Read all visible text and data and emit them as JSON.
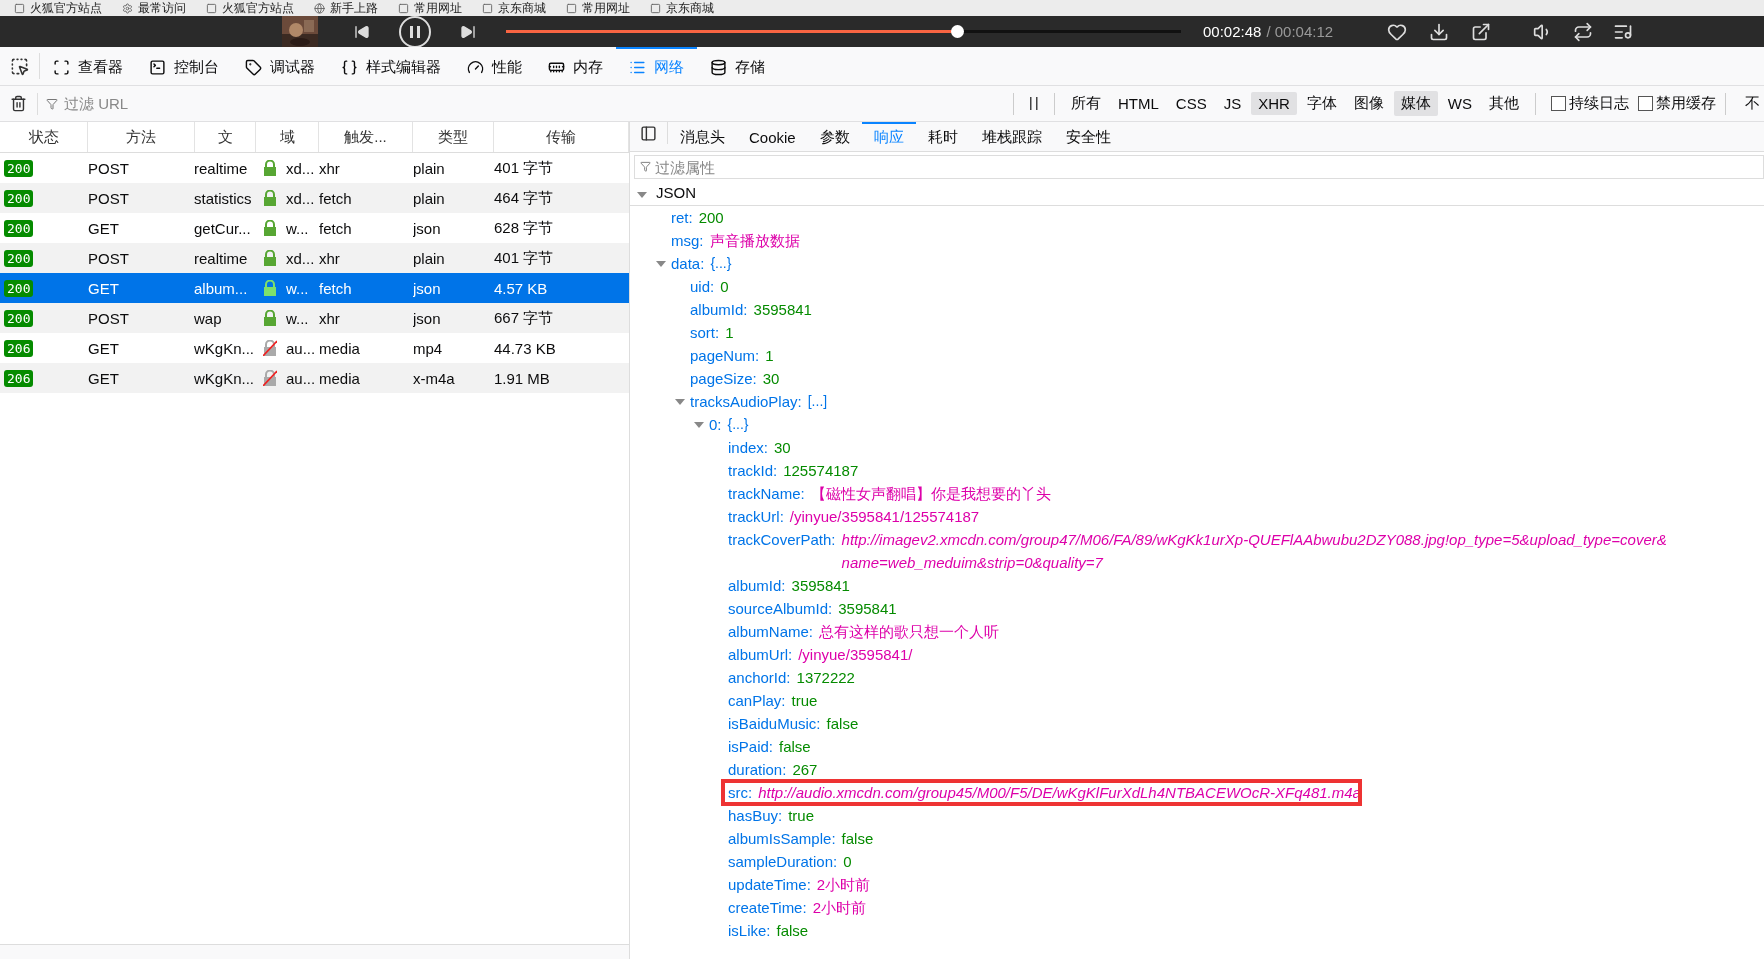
{
  "bookmarks": [
    {
      "label": "火狐官方站点"
    },
    {
      "label": "最常访问"
    },
    {
      "label": "火狐官方站点"
    },
    {
      "label": "新手上路"
    },
    {
      "label": "常用网址"
    },
    {
      "label": "京东商城"
    },
    {
      "label": "常用网址"
    },
    {
      "label": "京东商城"
    }
  ],
  "player": {
    "elapsed": "00:02:48",
    "total": "/ 00:04:12",
    "level": 0.668
  },
  "devtools_tabs": [
    {
      "label": "查看器",
      "selected": false
    },
    {
      "label": "控制台",
      "selected": false
    },
    {
      "label": "调试器",
      "selected": false
    },
    {
      "label": "样式编辑器",
      "selected": false
    },
    {
      "label": "性能",
      "selected": false
    },
    {
      "label": "内存",
      "selected": false
    },
    {
      "label": "网络",
      "selected": true
    },
    {
      "label": "存储",
      "selected": false
    }
  ],
  "filter": {
    "placeholder": "过滤 URL"
  },
  "type_filters": [
    {
      "label": "所有",
      "selected": false
    },
    {
      "label": "HTML",
      "selected": false
    },
    {
      "label": "CSS",
      "selected": false
    },
    {
      "label": "JS",
      "selected": false
    },
    {
      "label": "XHR",
      "selected": true
    },
    {
      "label": "字体",
      "selected": false
    },
    {
      "label": "图像",
      "selected": false
    },
    {
      "label": "媒体",
      "selected": true
    },
    {
      "label": "WS",
      "selected": false
    },
    {
      "label": "其他",
      "selected": false
    }
  ],
  "options": [
    {
      "label": "持续日志",
      "checked": false
    },
    {
      "label": "禁用缓存",
      "checked": false
    }
  ],
  "overflow_label": "不",
  "requests": {
    "columns": [
      "状态",
      "方法",
      "文",
      "域",
      "触发...",
      "类型",
      "传输"
    ],
    "rows": [
      {
        "status": "200",
        "method": "POST",
        "file": "realtime",
        "secure": true,
        "domain": "xd...",
        "cause": "xhr",
        "type": "plain",
        "transferred": "401 字节",
        "selected": false
      },
      {
        "status": "200",
        "method": "POST",
        "file": "statistics",
        "secure": true,
        "domain": "xd...",
        "cause": "fetch",
        "type": "plain",
        "transferred": "464 字节",
        "selected": false
      },
      {
        "status": "200",
        "method": "GET",
        "file": "getCur...",
        "secure": true,
        "domain": "w...",
        "cause": "fetch",
        "type": "json",
        "transferred": "628 字节",
        "selected": false
      },
      {
        "status": "200",
        "method": "POST",
        "file": "realtime",
        "secure": true,
        "domain": "xd...",
        "cause": "xhr",
        "type": "plain",
        "transferred": "401 字节",
        "selected": false
      },
      {
        "status": "200",
        "method": "GET",
        "file": "album...",
        "secure": true,
        "domain": "w...",
        "cause": "fetch",
        "type": "json",
        "transferred": "4.57 KB",
        "selected": true
      },
      {
        "status": "200",
        "method": "POST",
        "file": "wap",
        "secure": true,
        "domain": "w...",
        "cause": "xhr",
        "type": "json",
        "transferred": "667 字节",
        "selected": false
      },
      {
        "status": "206",
        "method": "GET",
        "file": "wKgKn...",
        "secure": false,
        "domain": "au...",
        "cause": "media",
        "type": "mp4",
        "transferred": "44.73 KB",
        "selected": false
      },
      {
        "status": "206",
        "method": "GET",
        "file": "wKgKn...",
        "secure": false,
        "domain": "au...",
        "cause": "media",
        "type": "x-m4a",
        "transferred": "1.91 MB",
        "selected": false
      }
    ]
  },
  "detail_tabs": [
    {
      "label": "消息头",
      "selected": false
    },
    {
      "label": "Cookie",
      "selected": false
    },
    {
      "label": "参数",
      "selected": false
    },
    {
      "label": "响应",
      "selected": true
    },
    {
      "label": "耗时",
      "selected": false
    },
    {
      "label": "堆栈跟踪",
      "selected": false
    },
    {
      "label": "安全性",
      "selected": false
    }
  ],
  "property_filter": {
    "placeholder": "过滤属性"
  },
  "response": {
    "root_label": "JSON",
    "expanded": true,
    "items": [
      {
        "key": "ret:",
        "value": "200",
        "kind": "number"
      },
      {
        "key": "msg:",
        "value": "声音播放数据",
        "kind": "string"
      },
      {
        "key": "data:",
        "value": "{...}",
        "kind": "object",
        "expanded": true,
        "children": [
          {
            "key": "uid:",
            "value": "0",
            "kind": "number"
          },
          {
            "key": "albumId:",
            "value": "3595841",
            "kind": "number"
          },
          {
            "key": "sort:",
            "value": "1",
            "kind": "number"
          },
          {
            "key": "pageNum:",
            "value": "1",
            "kind": "number"
          },
          {
            "key": "pageSize:",
            "value": "30",
            "kind": "number"
          },
          {
            "key": "tracksAudioPlay:",
            "value": "[...]",
            "kind": "object",
            "expanded": true,
            "children": [
              {
                "key": "0:",
                "value": "{...}",
                "kind": "object",
                "expanded": true,
                "children": [
                  {
                    "key": "index:",
                    "value": "30",
                    "kind": "number",
                    "highlighted": false
                  },
                  {
                    "key": "trackId:",
                    "value": "125574187",
                    "kind": "number",
                    "highlighted": false
                  },
                  {
                    "key": "trackName:",
                    "value": "【磁性女声翻唱】你是我想要的丫头",
                    "kind": "string",
                    "highlighted": false
                  },
                  {
                    "key": "trackUrl:",
                    "value": "/yinyue/3595841/125574187",
                    "kind": "string",
                    "highlighted": false
                  },
                  {
                    "key": "trackCoverPath:",
                    "value": "http://imagev2.xmcdn.com/group47/M06/FA/89/wKgKk1urXp-QUEFlAAbwubu2DZY088.jpg!op_type=5&upload_type=cover&",
                    "continuation": "name=web_meduim&strip=0&quality=7",
                    "kind": "url",
                    "highlighted": false
                  },
                  {
                    "key": "albumId:",
                    "value": "3595841",
                    "kind": "number",
                    "highlighted": false
                  },
                  {
                    "key": "sourceAlbumId:",
                    "value": "3595841",
                    "kind": "number",
                    "highlighted": false
                  },
                  {
                    "key": "albumName:",
                    "value": "总有这样的歌只想一个人听",
                    "kind": "string",
                    "highlighted": false
                  },
                  {
                    "key": "albumUrl:",
                    "value": "/yinyue/3595841/",
                    "kind": "string",
                    "highlighted": false
                  },
                  {
                    "key": "anchorId:",
                    "value": "1372222",
                    "kind": "number",
                    "highlighted": false
                  },
                  {
                    "key": "canPlay:",
                    "value": "true",
                    "kind": "number",
                    "highlighted": false
                  },
                  {
                    "key": "isBaiduMusic:",
                    "value": "false",
                    "kind": "number",
                    "highlighted": false
                  },
                  {
                    "key": "isPaid:",
                    "value": "false",
                    "kind": "number",
                    "highlighted": false
                  },
                  {
                    "key": "duration:",
                    "value": "267",
                    "kind": "number",
                    "highlighted": false
                  },
                  {
                    "key": "src:",
                    "value": "http://audio.xmcdn.com/group45/M00/F5/DE/wKgKlFurXdLh4NTBACEWOcR-XFq481.m4a",
                    "kind": "url",
                    "highlighted": true
                  },
                  {
                    "key": "hasBuy:",
                    "value": "true",
                    "kind": "number",
                    "highlighted": false
                  },
                  {
                    "key": "albumIsSample:",
                    "value": "false",
                    "kind": "number",
                    "highlighted": false
                  },
                  {
                    "key": "sampleDuration:",
                    "value": "0",
                    "kind": "number",
                    "highlighted": false
                  },
                  {
                    "key": "updateTime:",
                    "value": "2小时前",
                    "kind": "string",
                    "highlighted": false
                  },
                  {
                    "key": "createTime:",
                    "value": "2小时前",
                    "kind": "string",
                    "highlighted": false
                  },
                  {
                    "key": "isLike:",
                    "value": "false",
                    "kind": "number",
                    "highlighted": false
                  }
                ]
              }
            ]
          }
        ]
      }
    ]
  }
}
